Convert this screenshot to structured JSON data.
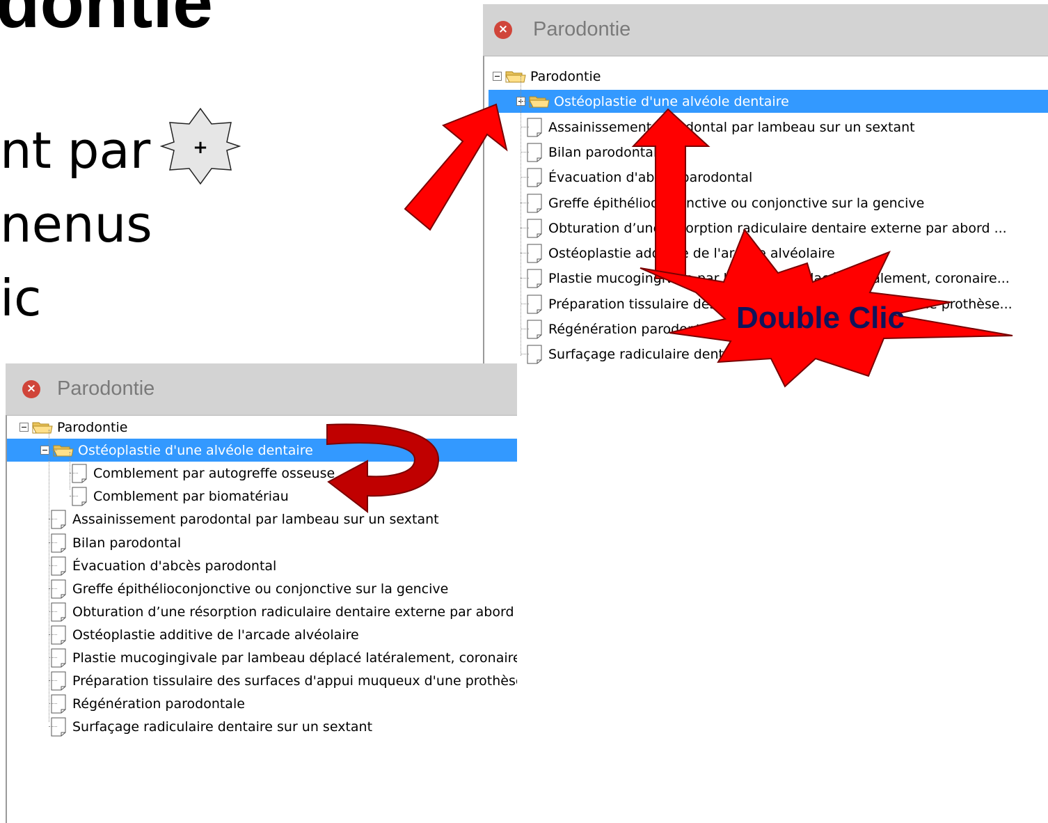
{
  "slide": {
    "title_fragment": "dontie",
    "lines": [
      "nt par",
      "nenus",
      "ic"
    ],
    "star_badge": "+"
  },
  "window_top": {
    "title": "Parodontie",
    "close_glyph": "×",
    "tree": [
      {
        "label": "Parodontie",
        "type": "folder",
        "level": 0,
        "expander": "minus",
        "selected": false
      },
      {
        "label": "Ostéoplastie d'une alvéole dentaire",
        "type": "folder",
        "level": 1,
        "expander": "plus",
        "selected": true
      },
      {
        "label": "Assainissement parodontal par lambeau sur un sextant",
        "type": "doc",
        "level": 1,
        "selected": false
      },
      {
        "label": "Bilan parodontal",
        "type": "doc",
        "level": 1,
        "selected": false
      },
      {
        "label": "Évacuation d'abcès parodontal",
        "type": "doc",
        "level": 1,
        "selected": false
      },
      {
        "label": "Greffe épithélioconjonctive ou conjonctive sur la gencive",
        "type": "doc",
        "level": 1,
        "selected": false
      },
      {
        "label": "Obturation d’une résorption radiculaire dentaire externe par abord ...",
        "type": "doc",
        "level": 1,
        "selected": false
      },
      {
        "label": "Ostéoplastie additive de l'arcade alvéolaire",
        "type": "doc",
        "level": 1,
        "selected": false
      },
      {
        "label": "Plastie mucogingivale par lambeau déplacé latéralement, coronaire...",
        "type": "doc",
        "level": 1,
        "selected": false
      },
      {
        "label": "Préparation tissulaire des surfaces d'appui muqueux d'une prothèse...",
        "type": "doc",
        "level": 1,
        "selected": false
      },
      {
        "label": "Régénération parodontale",
        "type": "doc",
        "level": 1,
        "selected": false
      },
      {
        "label": "Surfaçage radiculaire dentaire sur un sextant",
        "type": "doc",
        "level": 1,
        "selected": false
      }
    ]
  },
  "window_bottom": {
    "title": "Parodontie",
    "close_glyph": "×",
    "tree": [
      {
        "label": "Parodontie",
        "type": "folder",
        "level": 0,
        "expander": "minus",
        "selected": false
      },
      {
        "label": "Ostéoplastie d'une alvéole dentaire",
        "type": "folder",
        "level": 1,
        "expander": "minus",
        "selected": true
      },
      {
        "label": "Comblement par autogreffe osseuse",
        "type": "doc",
        "level": 2,
        "selected": false
      },
      {
        "label": "Comblement par biomatériau",
        "type": "doc",
        "level": 2,
        "selected": false
      },
      {
        "label": "Assainissement parodontal par lambeau sur un sextant",
        "type": "doc",
        "level": 1,
        "selected": false
      },
      {
        "label": "Bilan parodontal",
        "type": "doc",
        "level": 1,
        "selected": false
      },
      {
        "label": "Évacuation d'abcès parodontal",
        "type": "doc",
        "level": 1,
        "selected": false
      },
      {
        "label": "Greffe épithélioconjonctive ou conjonctive sur la gencive",
        "type": "doc",
        "level": 1,
        "selected": false
      },
      {
        "label": "Obturation d’une résorption radiculaire dentaire externe par abord ...",
        "type": "doc",
        "level": 1,
        "selected": false
      },
      {
        "label": "Ostéoplastie additive de l'arcade alvéolaire",
        "type": "doc",
        "level": 1,
        "selected": false
      },
      {
        "label": "Plastie mucogingivale par lambeau déplacé latéralement, coronaire...",
        "type": "doc",
        "level": 1,
        "selected": false
      },
      {
        "label": "Préparation tissulaire des surfaces d'appui muqueux d'une prothèse...",
        "type": "doc",
        "level": 1,
        "selected": false
      },
      {
        "label": "Régénération parodontale",
        "type": "doc",
        "level": 1,
        "selected": false
      },
      {
        "label": "Surfaçage radiculaire dentaire sur un sextant",
        "type": "doc",
        "level": 1,
        "selected": false
      }
    ]
  },
  "annotations": {
    "burst_label": "Double Clic"
  },
  "colors": {
    "selection": "#3399ff",
    "titlebar": "#d3d3d3",
    "close_button": "#d0453a",
    "arrow_red": "#ff0000",
    "curved_arrow": "#c00000",
    "burst_text": "#10145a"
  }
}
